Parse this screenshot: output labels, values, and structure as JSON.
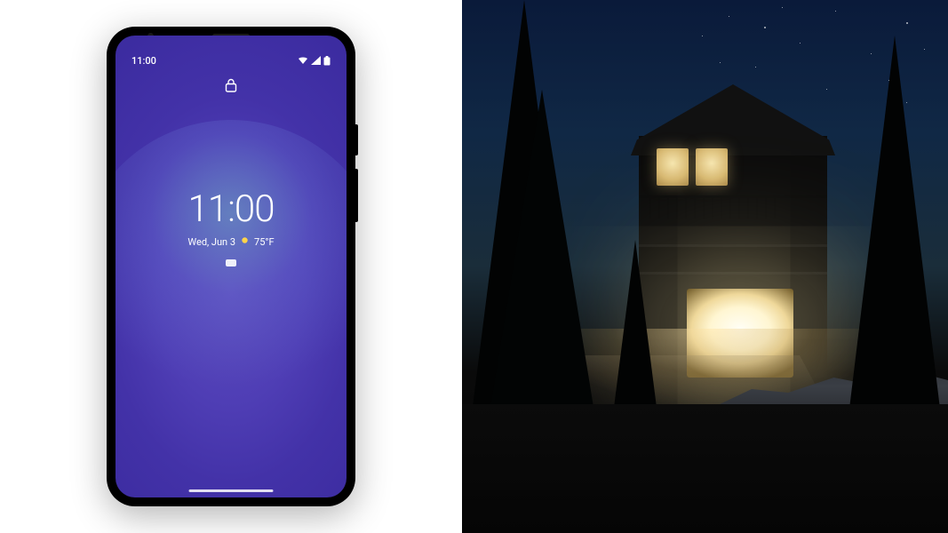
{
  "status_bar": {
    "time": "11:00"
  },
  "lock_screen": {
    "clock": "11:00",
    "date": "Wed, Jun 3",
    "temperature": "75°F"
  }
}
